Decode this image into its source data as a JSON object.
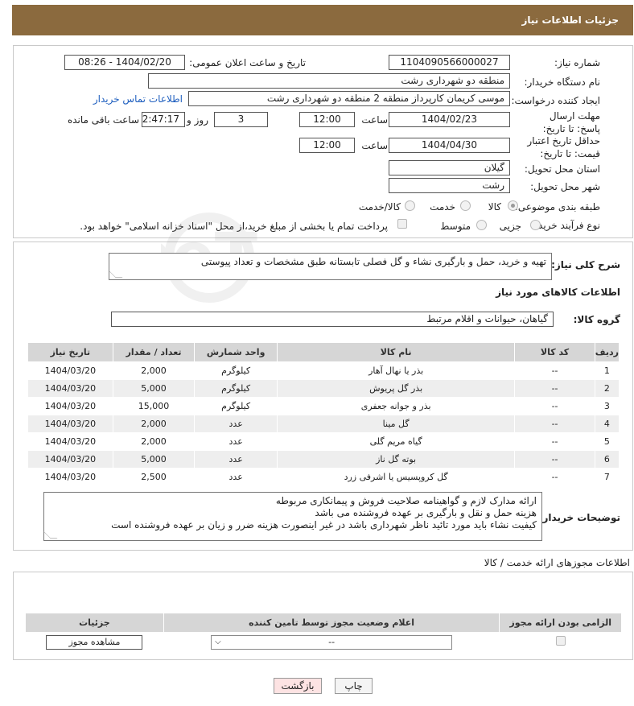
{
  "header": {
    "title": "جزئیات اطلاعات نیاز"
  },
  "form": {
    "need_number_label": "شماره نیاز:",
    "need_number": "1104090566000027",
    "announce_label": "تاریخ و ساعت اعلان عمومی:",
    "announce_value": "1404/02/20 - 08:26",
    "buyer_org_label": "نام دستگاه خریدار:",
    "buyer_org": "منطقه دو شهرداری رشت",
    "creator_label": "ایجاد کننده درخواست:",
    "creator": "موسی کریمان کارپرداز منطقه 2 منطقه دو شهرداری رشت",
    "contact_link": "اطلاعات تماس خریدار",
    "reply_deadline_label": "مهلت ارسال پاسخ: تا تاریخ:",
    "reply_date": "1404/02/23",
    "time_label": "ساعت",
    "reply_time": "12:00",
    "days_value": "3",
    "days_label": "روز و",
    "remaining_time": "02:47:17",
    "remaining_label": "ساعت باقی مانده",
    "price_validity_label": "حداقل تاریخ اعتبار قیمت: تا تاریخ:",
    "price_date": "1404/04/30",
    "price_time": "12:00",
    "province_label": "استان محل تحویل:",
    "province": "گیلان",
    "city_label": "شهر محل تحویل:",
    "city": "رشت",
    "category_label": "طبقه بندی موضوعی:",
    "category_options": [
      "کالا",
      "خدمت",
      "کالا/خدمت"
    ],
    "purchase_type_label": "نوع فرآیند خرید :",
    "purchase_options": [
      "جزیی",
      "متوسط"
    ],
    "payment_note": "پرداخت تمام یا بخشی از مبلغ خرید،از محل \"اسناد خزانه اسلامی\" خواهد بود."
  },
  "summary": {
    "label": "شرح کلی نیاز:",
    "text": "تهیه و خرید، حمل و بارگیری نشاء و گل فصلی تابستانه طبق مشخصات و تعداد پیوستی"
  },
  "goods": {
    "section_title": "اطلاعات کالاهای مورد نیاز",
    "group_label": "گروه کالا:",
    "group_value": "گیاهان، حیوانات و اقلام مرتبط",
    "columns": [
      "ردیف",
      "کد کالا",
      "نام کالا",
      "واحد شمارش",
      "تعداد / مقدار",
      "تاریخ نیاز"
    ],
    "rows": [
      [
        "1",
        "--",
        "بذر یا نهال آهار",
        "کیلوگرم",
        "2,000",
        "1404/03/20"
      ],
      [
        "2",
        "--",
        "بذر گل پریوش",
        "کیلوگرم",
        "5,000",
        "1404/03/20"
      ],
      [
        "3",
        "--",
        "بذر و جوانه جعفری",
        "کیلوگرم",
        "15,000",
        "1404/03/20"
      ],
      [
        "4",
        "--",
        "گل مینا",
        "عدد",
        "2,000",
        "1404/03/20"
      ],
      [
        "5",
        "--",
        "گیاه مریم گلی",
        "عدد",
        "2,000",
        "1404/03/20"
      ],
      [
        "6",
        "--",
        "بوته گل ناز",
        "عدد",
        "5,000",
        "1404/03/20"
      ],
      [
        "7",
        "--",
        "گل کروپسیس یا اشرفی زرد",
        "عدد",
        "2,500",
        "1404/03/20"
      ]
    ]
  },
  "buyer_notes": {
    "label": "توضیحات خریدار:",
    "lines": [
      "ارائه مدارک لازم و گواهینامه صلاحیت فروش و پیمانکاری مربوطه",
      "هزینه حمل و نقل و بارگیری بر عهده فروشنده می باشد",
      "کیفیت نشاء باید مورد تائید ناظر شهرداری باشد در غیر اینصورت هزینه ضرر و زیان بر عهده فروشنده است"
    ]
  },
  "permits": {
    "title": "اطلاعات مجوزهای ارائه خدمت / کالا",
    "columns": [
      "الزامی بودن ارائه مجوز",
      "اعلام وضعیت مجوز توسط تامین کننده",
      "جزئیات"
    ],
    "select_value": "--",
    "view_button": "مشاهده مجوز"
  },
  "actions": {
    "print": "چاپ",
    "back": "بازگشت"
  }
}
